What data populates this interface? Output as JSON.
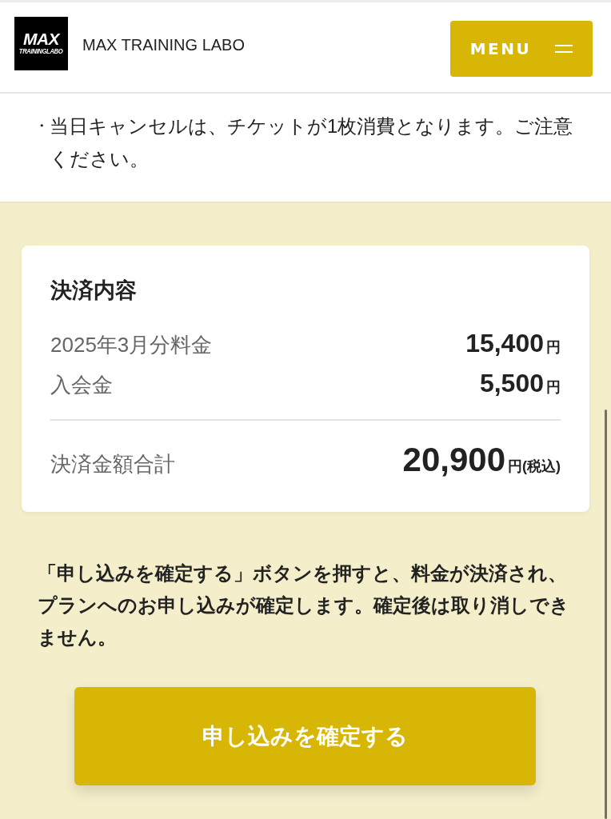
{
  "header": {
    "logo": {
      "line_1": "MAX",
      "line_2": "TRAININGLABO"
    },
    "site_name": "MAX TRAINING LABO",
    "menu_button": {
      "label": "MENU"
    }
  },
  "notes": [
    {
      "bullet": "・",
      "text": "当日キャンセルは、チケットが1枚消費となります。ご注意ください。"
    }
  ],
  "payment_summary": {
    "title": "決済内容",
    "items": [
      {
        "label": "2025年3月分料金",
        "amount": "15,400",
        "unit": "円"
      },
      {
        "label": "入会金",
        "amount": "5,500",
        "unit": "円"
      }
    ],
    "total": {
      "label": "決済金額合計",
      "amount": "20,900",
      "unit": "円(税込)"
    }
  },
  "notice": "「申し込みを確定する」ボタンを押すと、料金が決済され、プランへのお申し込みが確定します。確定後は取り消しできません。",
  "confirm_button": {
    "label": "申し込みを確定する"
  }
}
